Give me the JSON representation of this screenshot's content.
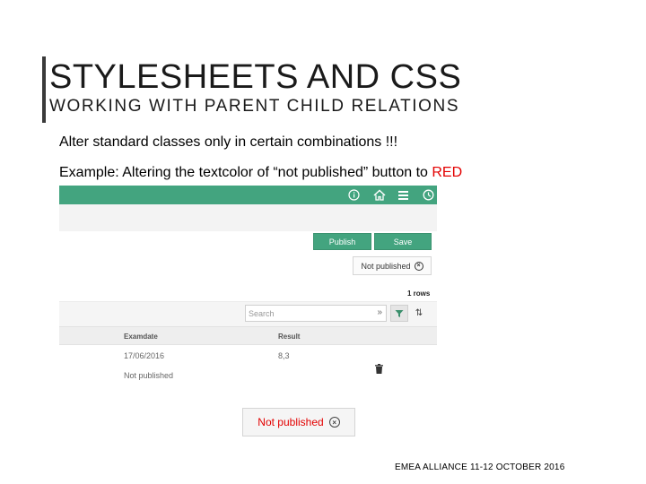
{
  "slide": {
    "title": "STYLESHEETS AND CSS",
    "subtitle": "WORKING WITH PARENT CHILD RELATIONS",
    "line1": "Alter standard classes only in certain combinations !!!",
    "line2_prefix": "Example: Altering the textcolor of “not published” button to ",
    "line2_highlight": "RED",
    "footer": "EMEA ALLIANCE   11-12 OCTOBER 2016"
  },
  "app": {
    "topbar_icons": [
      "info-icon",
      "home-icon",
      "menu-icon",
      "clock-icon"
    ],
    "publish_label": "Publish",
    "save_label": "Save",
    "not_published_small": "Not published",
    "rows_count": "1 rows",
    "search_placeholder": "Search",
    "columns": [
      "Examdate",
      "Result"
    ],
    "row": {
      "examdate": "17/06/2016",
      "result": "8,3",
      "status": "Not published"
    },
    "not_published_big": "Not published"
  },
  "colors": {
    "accent": "#43a47f",
    "highlight": "#e30000"
  }
}
